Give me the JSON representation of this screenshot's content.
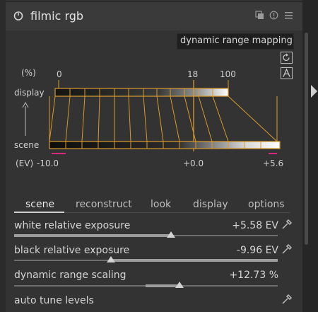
{
  "module": {
    "title": "filmic rgb",
    "graph_tag": "dynamic range mapping"
  },
  "graph": {
    "percent_label": "(%)",
    "display_label": "display",
    "scene_label": "scene",
    "ev_label": "(EV)",
    "display_ticks": [
      "0",
      "18",
      "100"
    ],
    "scene_ticks": [
      "-10.0",
      "+0.0",
      "+5.6"
    ]
  },
  "tabs": [
    "scene",
    "reconstruct",
    "look",
    "display",
    "options"
  ],
  "active_tab": "scene",
  "sliders": [
    {
      "name": "white relative exposure",
      "value": "+5.58 EV",
      "position": 0.61
    },
    {
      "name": "black relative exposure",
      "value": "-9.96 EV",
      "position": 0.36
    },
    {
      "name": "dynamic range scaling",
      "value": "+12.73 %",
      "position": 0.62
    }
  ],
  "auto_tune": "auto tune levels",
  "icons": {
    "power": "power-icon",
    "multi_instance": "multi-instance-icon",
    "reset": "reset-icon",
    "presets": "presets-menu-icon",
    "refresh": "refresh-icon",
    "text_mode": "text-mode-icon",
    "picker": "color-picker-icon",
    "expand": "expand-arrow-icon"
  },
  "colors": {
    "accent_orange": "#d89a2b",
    "marker_pink": "#d8287a"
  }
}
